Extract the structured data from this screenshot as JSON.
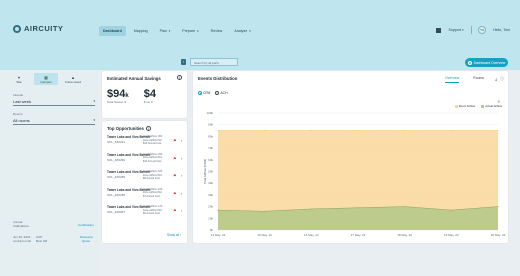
{
  "header": {
    "logo": "AIRCUITY",
    "nav": [
      {
        "label": "Dashboard",
        "active": true,
        "caret": false
      },
      {
        "label": "Mapping",
        "active": false,
        "caret": false
      },
      {
        "label": "Plan",
        "active": false,
        "caret": true
      },
      {
        "label": "Prepare",
        "active": false,
        "caret": true
      },
      {
        "label": "Review",
        "active": false,
        "caret": false
      },
      {
        "label": "Analyze",
        "active": false,
        "caret": true
      }
    ],
    "support_label": "Support",
    "avatar_initials": "TS",
    "user_greeting": "Hello, Tom"
  },
  "toolbar": {
    "search_placeholder": "Search by all parts",
    "dashboard_overview_label": "Dashboard Overview"
  },
  "sidebar": {
    "modes": [
      {
        "label": "Site",
        "icon": "pin-icon",
        "active": false
      },
      {
        "label": "Campus",
        "icon": "campus-icon",
        "active": true
      },
      {
        "label": "Fume Hood",
        "icon": "hood-icon",
        "active": false
      }
    ],
    "interval_label": "Interval",
    "interval_value": "Last week",
    "rooms_label": "Rooms",
    "rooms_value": "All rooms",
    "footer": {
      "annual_label": "Annual",
      "calibrations_label": "Calibrations",
      "certification_link": "Certification",
      "date_text": "Jun 20, 2023",
      "contract_label": "contract ends",
      "aom_text": "AOP",
      "best_text": "Best HR",
      "request_link": "Resource",
      "quote_link": "Quote"
    }
  },
  "savings": {
    "title": "Estimated Annual Savings",
    "total_value": "$94",
    "total_suffix": "k",
    "total_label": "Total Saved, $",
    "per_sqft_value": "$4",
    "per_sqft_label": "$ sq. ft"
  },
  "opportunities": {
    "title": "Top Opportunities",
    "show_all": "Show all",
    "items": [
      {
        "name": "Tower Labs and Vivo Benefit",
        "id": "SOL_ZZ0291",
        "meta1": "Zone Airflow: 30h",
        "meta2": "Zone Airflow Pkd",
        "meta3": "$12 Annual Cost"
      },
      {
        "name": "Tower Labs and Vivo Benefit",
        "id": "SOL_ZZ0290",
        "meta1": "Zone Airflow: 25h",
        "meta2": "Zone Airflow Pkd",
        "meta3": "$10 Annual Cost"
      },
      {
        "name": "Tower Labs and Vivo Benefit",
        "id": "SOL_ZZ0289",
        "meta1": "Zone Airflow: 18h",
        "meta2": "Zone Airflow Pkd",
        "meta3": "$8 Annual Cost"
      },
      {
        "name": "Tower Labs and Vivo Benefit",
        "id": "SOL_ZZ0288",
        "meta1": "Zone Airflow: 16h",
        "meta2": "Zone Airflow Pkd",
        "meta3": "$7 Annual Cost"
      },
      {
        "name": "Tower Labs and Vivo Benefit",
        "id": "SOL_ZZ0287",
        "meta1": "Zone Airflow: 12h",
        "meta2": "Zone Airflow Pkd",
        "meta3": "$6 Annual Cost"
      }
    ]
  },
  "events": {
    "title": "Events Distribution",
    "tabs": [
      {
        "label": "Overview",
        "active": true
      },
      {
        "label": "Rooms",
        "active": false
      }
    ],
    "units": [
      {
        "label": "CFM",
        "selected": true
      },
      {
        "label": "ACH",
        "selected": false
      }
    ]
  },
  "colors": {
    "header_bg": "#bfe6ef",
    "accent": "#18a0c4",
    "room_airflow": "#fad79a",
    "actual_airflow": "#b9c98b"
  },
  "chart_data": {
    "type": "area",
    "title": "",
    "xlabel": "",
    "ylabel": "Total Airflow (CFM)",
    "x": [
      "14 May, 22",
      "15 May, 22",
      "16 May, 22",
      "17 May, 22",
      "18 May, 22",
      "19 May, 22",
      "20 May, 22"
    ],
    "ylim": [
      0,
      100
    ],
    "yticks": [
      "0k",
      "10k",
      "20k",
      "30k",
      "40k",
      "50k",
      "60k",
      "70k",
      "80k",
      "90k",
      "100k"
    ],
    "series": [
      {
        "name": "Room Airflow",
        "values": [
          85,
          85,
          85,
          85,
          85,
          85,
          85
        ]
      },
      {
        "name": "Actual Airflow",
        "values": [
          17,
          16,
          18,
          19,
          20,
          17,
          20
        ]
      }
    ],
    "grid": true,
    "legend_position": "top-right"
  }
}
